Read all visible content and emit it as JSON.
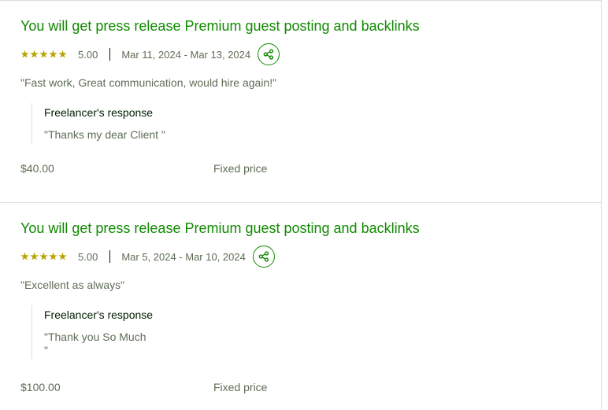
{
  "reviews": [
    {
      "title": "You will get press release Premium guest posting and backlinks",
      "rating": "5.00",
      "dates": "Mar 11, 2024 - Mar 13, 2024",
      "feedback": "\"Fast work, Great communication, would hire again!\"",
      "response_label": "Freelancer's response",
      "response_text": "\"Thanks my dear Client \"",
      "amount": "$40.00",
      "price_type": "Fixed price"
    },
    {
      "title": "You will get press release Premium guest posting and backlinks",
      "rating": "5.00",
      "dates": "Mar 5, 2024 - Mar 10, 2024",
      "feedback": "\"Excellent as always\"",
      "response_label": "Freelancer's response",
      "response_text": "\"Thank you So Much\n\"",
      "amount": "$100.00",
      "price_type": "Fixed price"
    }
  ],
  "icons": {
    "star": "star-icon",
    "share": "share-icon"
  },
  "colors": {
    "accent": "#108a00",
    "star": "#b8a300",
    "text_muted": "#5e6d55"
  }
}
